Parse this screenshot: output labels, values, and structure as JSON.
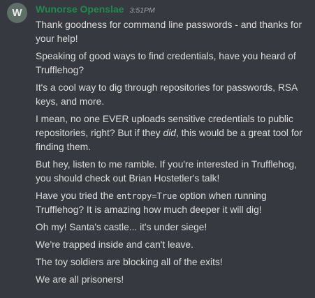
{
  "author": {
    "avatar_letter": "W",
    "name": "Wunorse Openslae",
    "timestamp": "3:51PM",
    "name_color": "#1f8b4c"
  },
  "messages": [
    {
      "text": "Thank goodness for command line passwords - and thanks for your help!"
    },
    {
      "text": "Speaking of good ways to find credentials, have you heard of Trufflehog?"
    },
    {
      "text": "It's a cool way to dig through repositories for passwords, RSA keys, and more."
    },
    {
      "before": "I mean, no one EVER uploads sensitive credentials to public repositories, right? But if they ",
      "emphasis": "did",
      "after": ", this would be a great tool for finding them."
    },
    {
      "text": "But hey, listen to me ramble. If you're interested in Trufflehog, you should check out Brian Hostetler's talk!"
    },
    {
      "before": "Have you tried the ",
      "code": "entropy=True",
      "after": " option when running Trufflehog? It is amazing how much deeper it will dig!"
    },
    {
      "text": "Oh my! Santa's castle... it's under siege!"
    },
    {
      "text": "We're trapped inside and can't leave."
    },
    {
      "text": "The toy soldiers are blocking all of the exits!"
    },
    {
      "text": "We are all prisoners!"
    }
  ]
}
